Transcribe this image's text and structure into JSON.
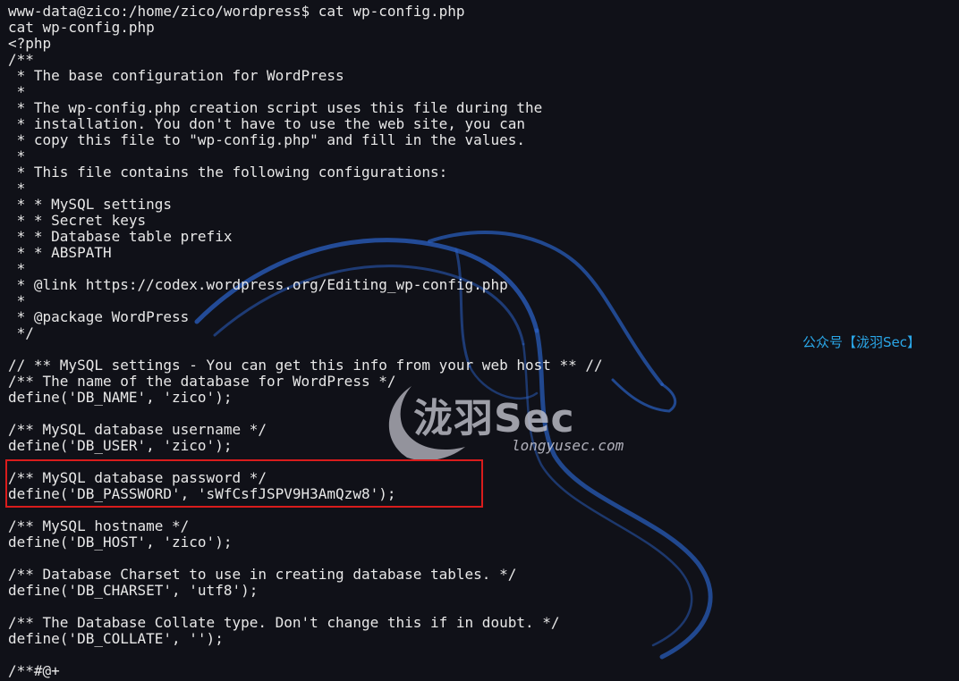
{
  "terminal": {
    "lines": [
      "www-data@zico:/home/zico/wordpress$ cat wp-config.php",
      "cat wp-config.php",
      "<?php",
      "/**",
      " * The base configuration for WordPress",
      " *",
      " * The wp-config.php creation script uses this file during the",
      " * installation. You don't have to use the web site, you can",
      " * copy this file to \"wp-config.php\" and fill in the values.",
      " *",
      " * This file contains the following configurations:",
      " *",
      " * * MySQL settings",
      " * * Secret keys",
      " * * Database table prefix",
      " * * ABSPATH",
      " *",
      " * @link https://codex.wordpress.org/Editing_wp-config.php",
      " *",
      " * @package WordPress",
      " */",
      "",
      "// ** MySQL settings - You can get this info from your web host ** //",
      "/** The name of the database for WordPress */",
      "define('DB_NAME', 'zico');",
      "",
      "/** MySQL database username */",
      "define('DB_USER', 'zico');",
      "",
      "/** MySQL database password */",
      "define('DB_PASSWORD', 'sWfCsfJSPV9H3AmQzw8');",
      "",
      "/** MySQL hostname */",
      "define('DB_HOST', 'zico');",
      "",
      "/** Database Charset to use in creating database tables. */",
      "define('DB_CHARSET', 'utf8');",
      "",
      "/** The Database Collate type. Don't change this if in doubt. */",
      "define('DB_COLLATE', '');",
      "",
      "/**#@+"
    ]
  },
  "watermark": {
    "logo_text": "泷羽Sec",
    "url": "longyusec.com",
    "account": "公众号【泷羽Sec】"
  },
  "colors": {
    "background": "#101118",
    "text": "#e8e8e8",
    "highlight_border": "#d91c1c",
    "dragon": "#2a5fc2",
    "account_text": "#2aa7e8"
  },
  "icons": {
    "background": "kali-dragon-icon",
    "logo": "longyu-swoosh-icon"
  }
}
